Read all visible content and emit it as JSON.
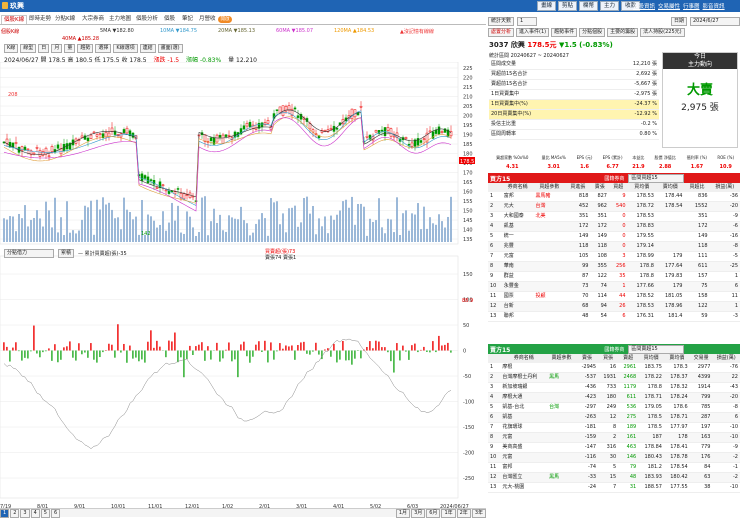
{
  "window": {
    "title": "玖興"
  },
  "toolbar": {
    "buttons": [
      "畫線",
      "剪貼",
      "欄幣",
      "主力",
      "收款"
    ],
    "links": [
      "個股資訊",
      "交易屬性",
      "行事曆",
      "影音資訊"
    ]
  },
  "left_tabs": {
    "items": [
      "個股K線",
      "即時走勢",
      "分點K線",
      "大宗券商",
      "主力地圖",
      "個股分析",
      "個股",
      "筆記",
      "月營收"
    ],
    "toggle": "開啟"
  },
  "ma_line1": {
    "prefix": "個股K線",
    "items": [
      "5MA ▼182.80",
      "10MA ▼184.75",
      "20MA ▼185.13",
      "60MA ▼185.07",
      "120MA ▲184.53"
    ],
    "note": "▲沒記憶有線線"
  },
  "ma_line2": {
    "items": [
      "40MA ▲185.28"
    ]
  },
  "chart_header": {
    "row1": [
      "K線",
      "線型",
      "日",
      "月",
      "量",
      "趨勢",
      "選擇",
      "K線選項",
      "連結",
      "畫面(選)"
    ],
    "row2": "2024/06/27 開 178.5 高 180.5 低 175.5 收 178.5",
    "change": "漲跌 -1.5",
    "pct": "漲幅 -0.83%",
    "vol": "量 12,210"
  },
  "price_axis": [
    "225",
    "220",
    "215",
    "210",
    "205",
    "200",
    "195",
    "190",
    "185",
    "180",
    "175",
    "170",
    "165",
    "160",
    "155",
    "150",
    "145",
    "140",
    "135"
  ],
  "price_marker": "178.5",
  "price_low": "142",
  "price_high_label": "208",
  "sub_header": {
    "select": "分點借力",
    "box": "累積",
    "legend": "— 累計買賣超(張)-35",
    "legend2": "買賣超(張)73",
    "legend3": "賣張74 賣張1"
  },
  "sub_axis": [
    "150",
    "100",
    "50",
    "0",
    "-50",
    "-100",
    "-150",
    "-200",
    "-250"
  ],
  "sub_marker": "88.9",
  "date_axis": [
    "7/19",
    "8/01",
    "9/01",
    "10/01",
    "11/01",
    "12/01",
    "1/02",
    "2/01",
    "3/01",
    "4/01",
    "5/02",
    "6/03",
    "2024/06/27"
  ],
  "year_labels": [
    "2023",
    "2024"
  ],
  "bottom_pages": [
    "1",
    "2",
    "3",
    "4",
    "5",
    "6"
  ],
  "bottom_ranges": [
    "1月",
    "3月",
    "6月",
    "1年",
    "2年",
    "3年"
  ],
  "right_top": {
    "tabs": [
      "統計天數",
      "1"
    ],
    "date_btn": "日期",
    "date": "2024/6/27",
    "nav": [
      "處置分析",
      "進入事件(1)",
      "趨勢事件",
      "分點個股",
      "主要的籌股",
      "法人持股(225元)"
    ]
  },
  "stock": {
    "code_name": "3037 欣興",
    "price": "178.5元",
    "change": "▼1.5 (-0.83%)",
    "period_label": "統計區間",
    "period": "20240627 ~ 20240627",
    "today_label": "今日",
    "force_label": "主力動向",
    "force_title": "大賣",
    "force_value": "2,975 張",
    "stats": [
      [
        "區間成交量",
        "",
        "12,210 張"
      ],
      [
        "買超前15名合計",
        "",
        "2,692 張"
      ],
      [
        "賣超前15名合計",
        "",
        "-5,667 張"
      ],
      [
        "1日買賣集中",
        "",
        "-2,975 張"
      ],
      [
        "1日買賣集中(%)",
        "",
        "-24.37 %"
      ],
      [
        "20日買賣集中(%)",
        "",
        "-12.92 %"
      ],
      [
        "投信主比重",
        "",
        "-0.2 %"
      ],
      [
        "區間周轉率",
        "",
        "0.80 %"
      ]
    ]
  },
  "ratios": {
    "headers": [
      "買超家數\n%0x%0",
      "量比\nMA5x%",
      "EPS\n(元)",
      "EPS\n(累計)",
      "本益比",
      "股價\n淨值比",
      "殖利率\n(%)",
      "ROE\n(%)"
    ],
    "values": [
      "4.31",
      "3.01",
      "1.6",
      "6.77",
      "21.9",
      "2.88",
      "1.67",
      "10.9"
    ]
  },
  "buy_table": {
    "title": "買方15",
    "sub": "國籍券商",
    "select": "區間買超15",
    "cols": [
      "",
      "券商名稱",
      "買超參數",
      "買進張",
      "賣張",
      "買超",
      "買均價",
      "賣均價",
      "買超比",
      "損益(萬)"
    ],
    "rows": [
      [
        "1",
        "富邦",
        "黑馬豬",
        "818",
        "827",
        "9",
        "178.53",
        "178.44",
        "836",
        "-36"
      ],
      [
        "2",
        "元大",
        "台灣",
        "452",
        "962",
        "540",
        "178.72",
        "178.54",
        "1552",
        "-20"
      ],
      [
        "3",
        "大和國泰",
        "北美",
        "351",
        "351",
        "0",
        "178.53",
        "",
        "351",
        "-9"
      ],
      [
        "4",
        "凱基",
        "",
        " 172",
        "172",
        "0",
        "178.83",
        "",
        "172",
        "-6"
      ],
      [
        "5",
        "統一",
        "",
        "149",
        "149",
        "0",
        "179.55",
        "",
        "149",
        "-16"
      ],
      [
        "6",
        "兆豐",
        "",
        "118",
        "118",
        "0",
        "179.14",
        "",
        "118",
        "-8"
      ],
      [
        "7",
        "元富",
        "",
        "105",
        "108",
        "3",
        "178.99",
        "179",
        "111",
        "-5"
      ],
      [
        "8",
        "華南",
        "",
        "99",
        "355",
        "256",
        "178.8",
        "177.64",
        "611",
        "-25"
      ],
      [
        "9",
        "群益",
        "",
        "87",
        "122",
        "35",
        "178.8",
        "179.83",
        "157",
        "1"
      ],
      [
        "10",
        "永豐金",
        "",
        "73",
        "74",
        "1",
        "177.66",
        "179",
        "75",
        "6"
      ],
      [
        "11",
        "國票",
        "投顧",
        "70",
        "114",
        "44",
        "178.52",
        "181.05",
        "158",
        "11"
      ],
      [
        "12",
        "台新",
        "",
        "68",
        "94",
        "26",
        "178.53",
        "178.96",
        "122",
        "1"
      ],
      [
        "13",
        "聯邦",
        "",
        "48",
        "54",
        "6",
        "176.31",
        "181.4",
        "59",
        "-3"
      ]
    ]
  },
  "sell_table": {
    "title": "賣方15",
    "sub": "國籍券商",
    "select": "區間賣超15",
    "cols": [
      "",
      "券商名稱",
      "賣超參數",
      "賣張",
      "買張",
      "賣超",
      "買均價",
      "賣均價",
      "交易量",
      "損益(萬)"
    ],
    "rows": [
      [
        "1",
        "摩根",
        "",
        "-2945",
        "16",
        "2961",
        "183.75",
        "178.3",
        "2977",
        "-76"
      ],
      [
        "2",
        "台灣摩根士丹利",
        "黑馬",
        "-537",
        "1931",
        "2468",
        "178.22",
        "178.37",
        "4399",
        "22"
      ],
      [
        "3",
        "新加坡瑞銀",
        "",
        "-436",
        "733",
        "1179",
        "178.8",
        "178.32",
        "1914",
        "-43"
      ],
      [
        "4",
        "摩根大通",
        "",
        "-423",
        "180",
        "611",
        "178.71",
        "178.24",
        "799",
        "-20"
      ],
      [
        "5",
        "凱基-台北",
        "台灣",
        "-297",
        "249",
        "536",
        "179.05",
        "178.6",
        "785",
        "-8"
      ],
      [
        "6",
        "凱基",
        "",
        "-263",
        "12",
        "275",
        "178.5",
        "178.71",
        "287",
        "6"
      ],
      [
        "7",
        "花旗環球",
        "",
        "-181",
        "8",
        "189",
        "178.5",
        "177.97",
        "197",
        "-10"
      ],
      [
        "8",
        "元富",
        "",
        "-159",
        "2",
        "161",
        "187",
        "178",
        "163",
        "-10"
      ],
      [
        "9",
        "美商高盛",
        "",
        "-147",
        "316",
        "463",
        "178.84",
        "178.41",
        "779",
        "-9"
      ],
      [
        "10",
        "元富",
        "",
        "-116",
        "30",
        "146",
        "180.43",
        "178.78",
        "176",
        "-2"
      ],
      [
        "11",
        "富邦",
        "",
        "-74",
        "5",
        "79",
        "181.2",
        "178.54",
        "84",
        "-1"
      ],
      [
        "12",
        "台灣匯立",
        "黑馬",
        "-33",
        "15",
        "48",
        "183.93",
        "180.42",
        "63",
        "-2"
      ],
      [
        "13",
        "元大-桃園",
        "",
        "-24",
        "7",
        "31",
        "188.57",
        "177.55",
        "38",
        "-10"
      ]
    ]
  }
}
